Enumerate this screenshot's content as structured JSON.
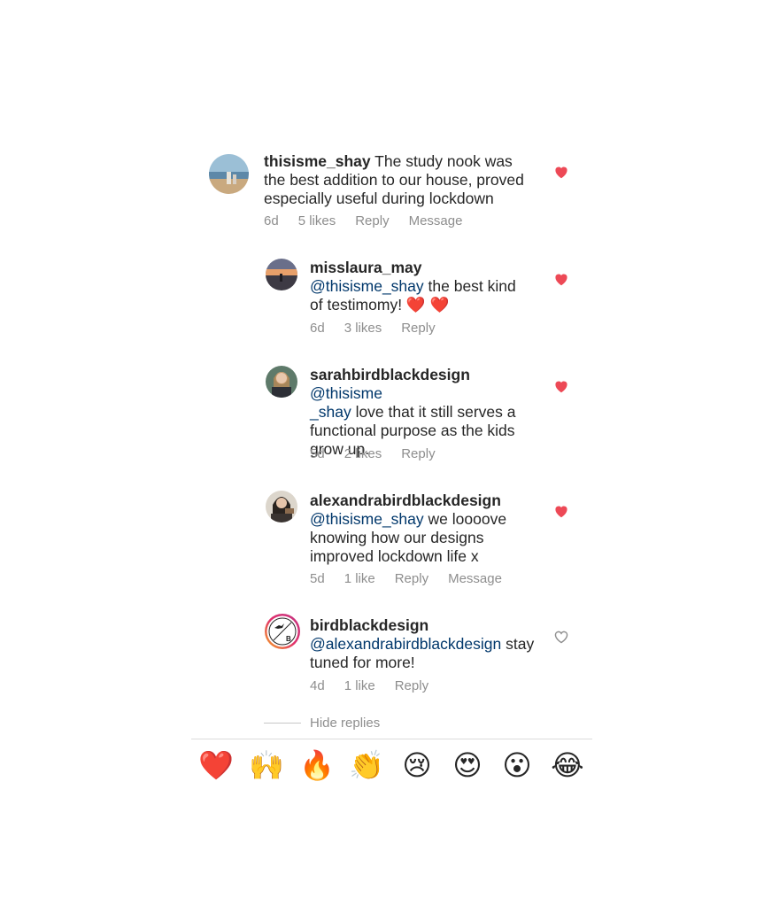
{
  "comments": [
    {
      "username": "thisisme_shay",
      "mention": "",
      "text": " The study nook was the best addition to our house, proved especially useful during lockdown",
      "age": "6d",
      "likes": "5 likes",
      "reply": "Reply",
      "message": "Message",
      "liked": true
    },
    {
      "username": "misslaura_may",
      "mention": "@thisisme_shay",
      "text": " the best kind of testimomy! ❤️ ❤️",
      "age": "6d",
      "likes": "3 likes",
      "reply": "Reply",
      "liked": true
    },
    {
      "username": "sarahbirdblackdesign",
      "mention": "@thisisme_shay",
      "text": " love that it still serves a functional purpose as the kids grow up.",
      "age": "5d",
      "likes": "2 likes",
      "reply": "Reply",
      "liked": true
    },
    {
      "username": "alexandrabirdblackdesign",
      "mention": "@thisisme_shay",
      "text": " we loooove knowing how our designs improved lockdown life x",
      "age": "5d",
      "likes": "1 like",
      "reply": "Reply",
      "message": "Message",
      "liked": true
    },
    {
      "username": "birdblackdesign",
      "mention": "@alexandrabirdblackdesign",
      "text": " stay tuned for more!",
      "age": "4d",
      "likes": "1 like",
      "reply": "Reply",
      "liked": false
    }
  ],
  "hide_replies": "Hide replies",
  "reactions": [
    "❤️",
    "🙌",
    "🔥",
    "👏",
    "😢",
    "😍",
    "😮",
    "😂"
  ],
  "colors": {
    "like_red": "#ed4956",
    "mention_blue": "#00376b",
    "meta_gray": "#8e8e8e"
  }
}
